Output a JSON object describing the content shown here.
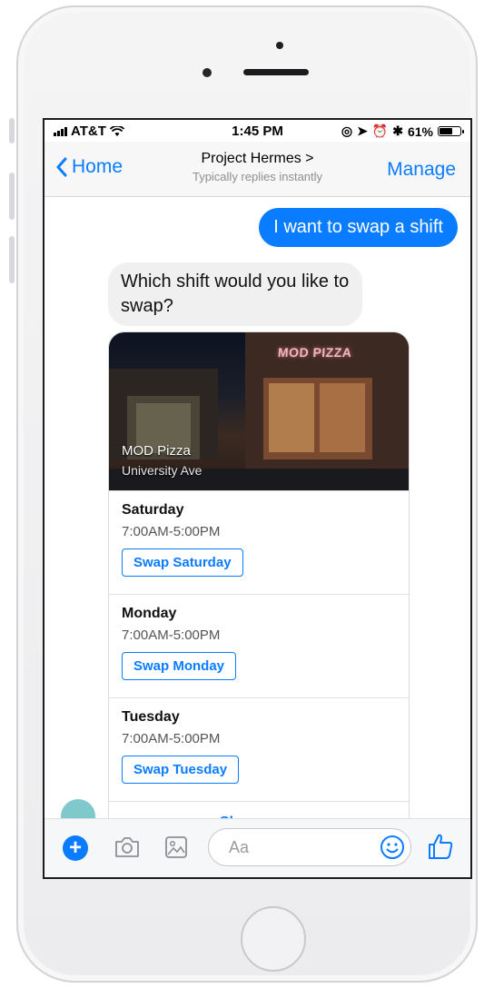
{
  "status_bar": {
    "carrier": "AT&T",
    "time": "1:45 PM",
    "battery": "61%"
  },
  "nav": {
    "back_label": "Home",
    "title": "Project Hermes >",
    "subtitle": "Typically replies instantly",
    "manage_label": "Manage"
  },
  "messages": {
    "outgoing": "I want to swap a shift",
    "incoming": "Which shift would you like to swap?"
  },
  "card": {
    "image_sign": "MOD PIZZA",
    "location_name": "MOD Pizza",
    "location_street": "University Ave",
    "shifts": [
      {
        "day": "Saturday",
        "time": "7:00AM-5:00PM",
        "button": "Swap Saturday"
      },
      {
        "day": "Monday",
        "time": "7:00AM-5:00PM",
        "button": "Swap Monday"
      },
      {
        "day": "Tuesday",
        "time": "7:00AM-5:00PM",
        "button": "Swap Tuesday"
      }
    ],
    "show_more": "Show more"
  },
  "composer": {
    "placeholder": "Aa"
  },
  "colors": {
    "accent": "#0a7cff",
    "bubble_in": "#f0f0f0"
  },
  "icons": [
    "signal-bars-icon",
    "wifi-icon",
    "back-chevron-icon",
    "plus-icon",
    "camera-icon",
    "gallery-icon",
    "emoji-icon",
    "thumbs-up-icon",
    "battery-icon"
  ]
}
